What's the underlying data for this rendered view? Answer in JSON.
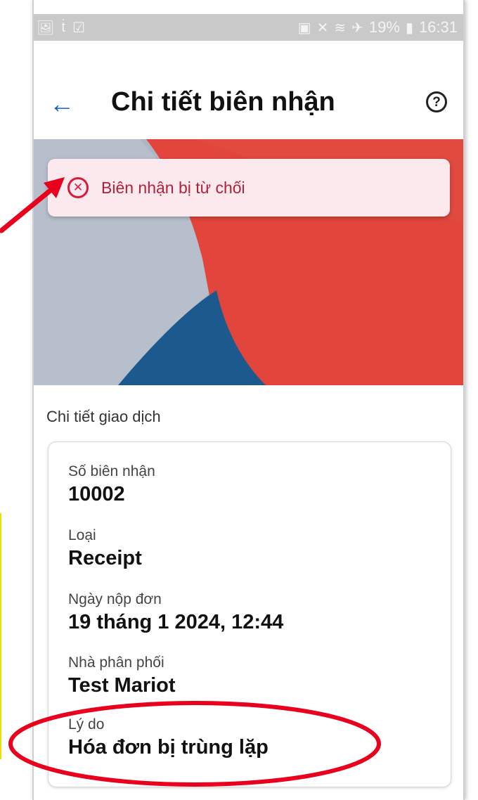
{
  "status_bar": {
    "left_icons": [
      "gallery-icon",
      "teams-icon",
      "checkbox-icon"
    ],
    "battery": "19%",
    "time": "16:31"
  },
  "header": {
    "title": "Chi tiết biên nhận",
    "back_icon": "arrow-left-icon",
    "help_icon": "help-circle-icon"
  },
  "banner": {
    "text": "Biên nhận bị từ chối",
    "icon": "close-circle-icon",
    "color": "#d81b3c"
  },
  "section": {
    "title": "Chi tiết giao dịch"
  },
  "details": [
    {
      "label": "Số biên nhận",
      "value": "10002"
    },
    {
      "label": "Loại",
      "value": "Receipt"
    },
    {
      "label": "Ngày nộp đơn",
      "value": "19 tháng 1 2024, 12:44"
    },
    {
      "label": "Nhà phân phối",
      "value": "Test Mariot"
    },
    {
      "label": "Lý do",
      "value": "Hóa đơn bị trùng lặp"
    }
  ],
  "colors": {
    "accent": "#1565c0",
    "annotation": "#e8001c"
  }
}
